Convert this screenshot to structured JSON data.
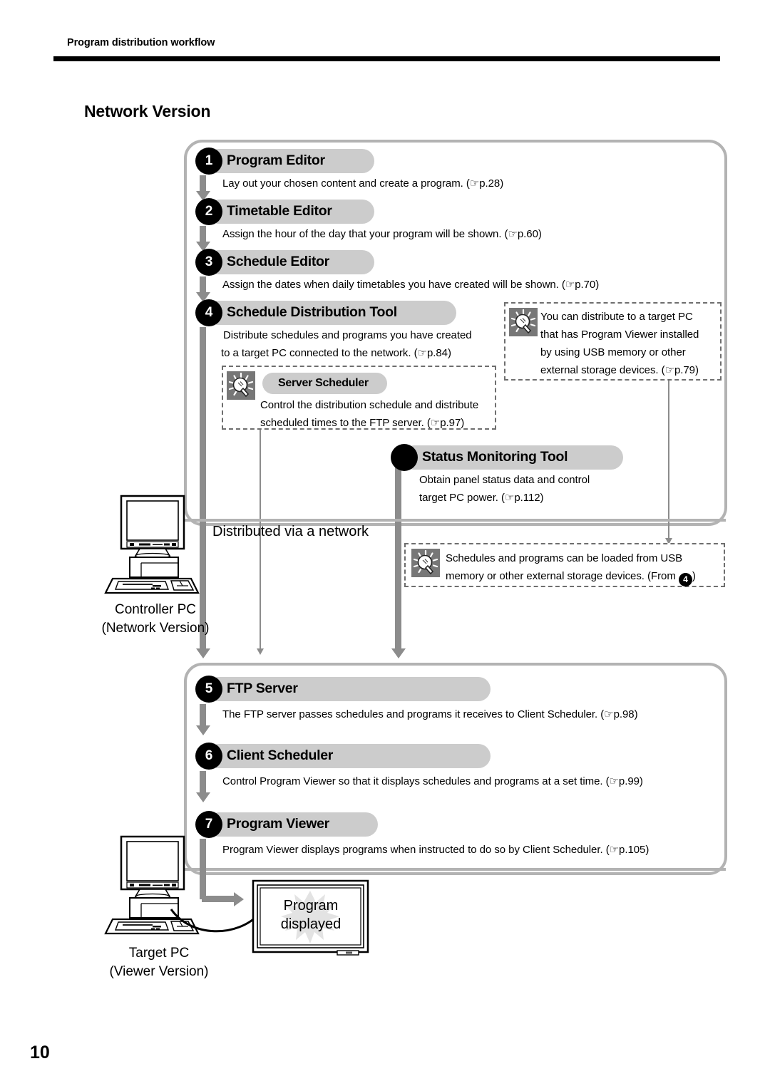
{
  "header": {
    "running_head": "Program distribution workflow"
  },
  "section": {
    "title": "Network Version"
  },
  "page": {
    "number": "10"
  },
  "steps": [
    {
      "badge": "1",
      "label": "Program Editor",
      "desc_lines": [
        "Lay out your chosen content and create a program. (☞p.28)"
      ]
    },
    {
      "badge": "2",
      "label": "Timetable Editor",
      "desc_lines": [
        "Assign the hour of the day that your program will be shown. (☞p.60)"
      ]
    },
    {
      "badge": "3",
      "label": "Schedule Editor",
      "desc_lines": [
        "Assign the dates when daily timetables you have created will be shown. (☞p.70)"
      ]
    },
    {
      "badge": "4",
      "label": "Schedule Distribution Tool",
      "desc_lines": [
        "Distribute schedules and programs you have created",
        "to a target PC connected to the network. (☞p.84)"
      ]
    },
    {
      "badge": "",
      "label": "Status Monitoring Tool",
      "desc_lines": [
        "Obtain panel status data and control",
        "target PC power. (☞p.112)"
      ]
    },
    {
      "badge": "5",
      "label": "FTP Server",
      "desc_lines": [
        "The FTP server passes schedules and programs it receives to Client Scheduler. (☞p.98)"
      ]
    },
    {
      "badge": "6",
      "label": "Client Scheduler",
      "desc_lines": [
        "Control Program Viewer so that it displays schedules and programs at a set time. (☞p.99)"
      ]
    },
    {
      "badge": "7",
      "label": "Program Viewer",
      "desc_lines": [
        "Program Viewer displays programs when instructed to do so by Client Scheduler. (☞p.105)"
      ]
    }
  ],
  "tips": {
    "server_scheduler": {
      "label": "Server Scheduler",
      "lines": [
        "Control the distribution schedule and distribute",
        "scheduled times to the FTP server. (☞p.97)"
      ]
    },
    "usb_distribute": {
      "lines": [
        "You can distribute to a target PC",
        "that has Program Viewer installed",
        "by using USB memory or other",
        "external storage devices. (☞p.79)"
      ]
    },
    "usb_load": {
      "line1": "Schedules and programs can be loaded from USB",
      "line2_pre": "memory or other external storage devices. (From ",
      "line2_badge": "4",
      "line2_post": ")"
    }
  },
  "diagram": {
    "network_text": "Distributed via a network",
    "controller_pc": {
      "line1": "Controller PC",
      "line2": "(Network Version)"
    },
    "target_pc": {
      "line1": "Target PC",
      "line2": "(Viewer Version)"
    },
    "display_burst": {
      "line1": "Program",
      "line2": "displayed"
    }
  },
  "colors": {
    "pill_grey": "#cccccc",
    "badge_black": "#000000",
    "panel_border": "#b3b3b3",
    "arrow_grey": "#8c8c8c",
    "bulb_bg": "#777777"
  }
}
